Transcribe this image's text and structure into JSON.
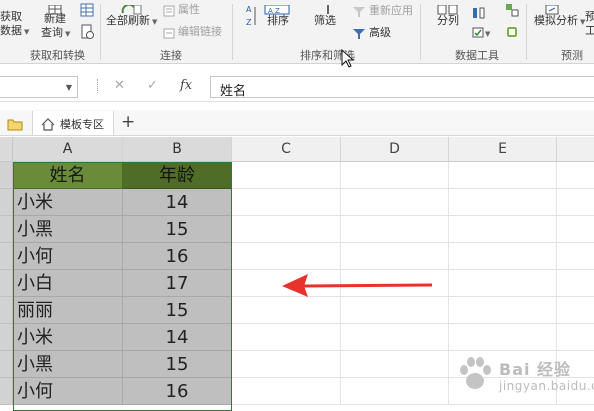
{
  "ribbon": {
    "get_data_label_1": "获取",
    "get_data_label_2": "数据",
    "new_query_label_1": "新建",
    "new_query_label_2": "查询",
    "get_transform_group": "获取和转换",
    "refresh_all_label": "全部刷新",
    "properties_label": "属性",
    "edit_links_label": "编辑链接",
    "connections_group": "连接",
    "sort_label": "排序",
    "filter_label": "筛选",
    "reapply_label": "重新应用",
    "advanced_label": "高级",
    "sort_filter_group": "排序和筛选",
    "split_label": "分列",
    "data_tools_group": "数据工具",
    "what_if_label": "模拟分析",
    "forecast_sheet_label": "工",
    "forecast_group": "预测",
    "sort_az_glyph": "A Z"
  },
  "formula_bar": {
    "cancel_glyph": "✕",
    "enter_glyph": "✓",
    "fx_glyph": "fx",
    "content": "姓名"
  },
  "tabs": {
    "template_tab": "模板专区",
    "add_tab_glyph": "+"
  },
  "columns": [
    "A",
    "B",
    "C",
    "D",
    "E"
  ],
  "table": {
    "headers": [
      "姓名",
      "年龄"
    ],
    "rows": [
      [
        "小米",
        "14"
      ],
      [
        "小黑",
        "15"
      ],
      [
        "小何",
        "16"
      ],
      [
        "小白",
        "17"
      ],
      [
        "丽丽",
        "15"
      ],
      [
        "小米",
        "14"
      ],
      [
        "小黑",
        "15"
      ],
      [
        "小何",
        "16"
      ]
    ]
  },
  "watermark": {
    "line1": "Bai 经验",
    "line2": "jingyan.baidu.com"
  },
  "colors": {
    "header_green_a": "#6a8c3a",
    "header_green_b": "#4f6d26",
    "selection_gray": "#bfbfbf",
    "arrow_red": "#e8322b"
  }
}
